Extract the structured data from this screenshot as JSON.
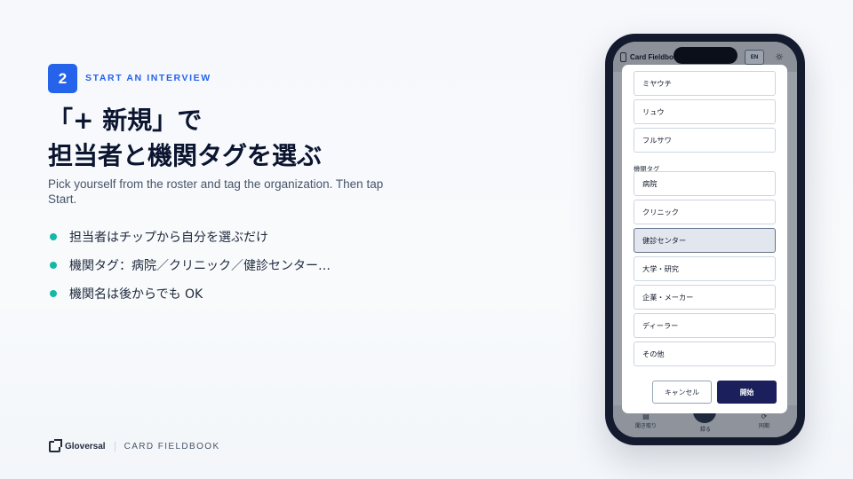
{
  "step": {
    "number": "2",
    "label": "START AN INTERVIEW"
  },
  "headline": {
    "line1": "「+ 新規」で",
    "line2": "担当者と機関タグを選ぶ"
  },
  "subtitle": "Pick yourself from the roster and tag the organization. Then tap Start.",
  "bullets": [
    "担当者はチップから自分を選ぶだけ",
    "機関タグ：病院／クリニック／健診センター…",
    "機関名は後からでも OK"
  ],
  "footer": {
    "brand": "Gloversal",
    "product": "CARD FIELDBOOK"
  },
  "phone": {
    "app_title": "Card Fieldbook",
    "lang_button": "EN",
    "theme_icon": "sun-icon",
    "modal": {
      "staff_options": [
        "ミヤウチ",
        "リュウ",
        "フルサワ"
      ],
      "org_tag_label": "機関タグ",
      "org_tags": [
        "病院",
        "クリニック",
        "健診センター",
        "大学・研究",
        "企業・メーカー",
        "ディーラー",
        "その他"
      ],
      "selected_org_tag": "健診センター",
      "cancel_label": "キャンセル",
      "start_label": "開始"
    },
    "bottom_nav": {
      "left_label": "聞き取り",
      "center_label": "録る",
      "right_label": "同期"
    }
  },
  "colors": {
    "accent_blue": "#2563eb",
    "bullet_teal": "#14b8a6",
    "start_button": "#1b1f5c",
    "phone_frame": "#141b2e"
  }
}
